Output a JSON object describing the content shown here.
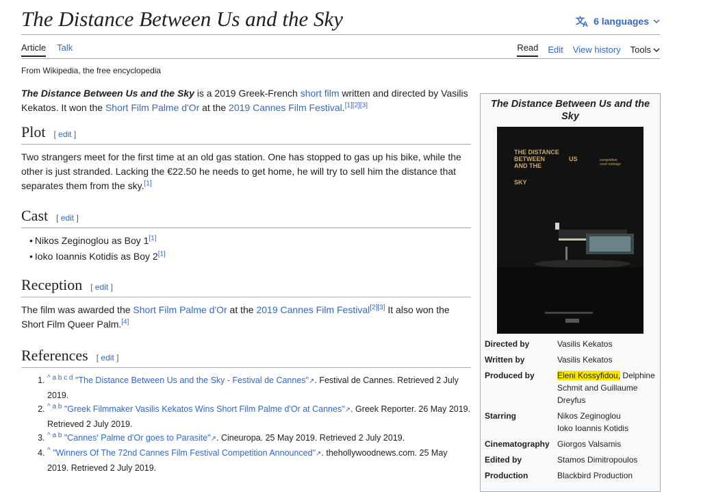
{
  "article": {
    "title": "The Distance Between Us and the Sky",
    "languages": "6 languages",
    "tabs": {
      "article": "Article",
      "talk": "Talk"
    },
    "actions": {
      "read": "Read",
      "edit": "Edit",
      "history": "View history",
      "tools": "Tools"
    },
    "tagline": "From Wikipedia, the free encyclopedia"
  },
  "intro": {
    "bold": "The Distance Between Us and the Sky",
    "t1": " is a 2019 Greek-French ",
    "link1": "short film",
    "t2": " written and directed by Vasilis Kekatos. It won the ",
    "link2": "Short Film Palme d'Or",
    "t3": " at the ",
    "link3": "2019 Cannes Film Festival",
    "t4": ".",
    "refs": "[1][2][3]"
  },
  "edit_label": "edit",
  "plot": {
    "heading": "Plot",
    "text": "Two strangers meet for the first time at an old gas station. One has stopped to gas up his bike, while the other is just stranded. Lacking the €22.50 he needs to get home, he will try to sell him the distance that separates them from the sky.",
    "ref": "[1]"
  },
  "cast": {
    "heading": "Cast",
    "items": [
      {
        "text": "Nikos Zeginoglou as Boy 1",
        "ref": "[1]"
      },
      {
        "text": "Ioko Ioannis Kotidis as Boy 2",
        "ref": "[1]"
      }
    ]
  },
  "reception": {
    "heading": "Reception",
    "t1": "The film was awarded the ",
    "link1": "Short Film Palme d'Or",
    "t2": " at the ",
    "link2": "2019 Cannes Film Festival",
    "refs1": "[2][3]",
    "t3": " It also won the Short Film Queer Palm.",
    "ref2": "[4]"
  },
  "references": {
    "heading": "References",
    "items": [
      {
        "back": "^ a b c d",
        "link": "\"The Distance Between Us and the Sky - Festival de Cannes\"",
        "rest": ". Festival de Cannes. Retrieved 2 July 2019."
      },
      {
        "back": "^ a b",
        "link": "\"Greek Filmmaker Vasilis Kekatos Wins Short Film Palme d'Or at Cannes\"",
        "rest": ". Greek Reporter. 26 May 2019. Retrieved 2 July 2019."
      },
      {
        "back": "^ a b",
        "link": "\"Cannes' Palme d'Or goes to Parasite\"",
        "rest": ". Cineuropa. 25 May 2019. Retrieved 2 July 2019."
      },
      {
        "back": "^",
        "link": "\"Winners Of The 72nd Cannes Film Festival Competition Announced\"",
        "rest": ". thehollywoodnews.com. 25 May 2019. Retrieved 2 July 2019."
      }
    ]
  },
  "infobox": {
    "title": "The Distance Between Us and the Sky",
    "poster": {
      "line1": "THE DISTANCE",
      "line2": "BETWEEN",
      "word_us": "US",
      "line3": "AND THE",
      "line4": "SKY",
      "badge1": "competition",
      "badge2": "court métrage"
    },
    "rows": [
      {
        "k": "Directed by",
        "v": "Vasilis Kekatos"
      },
      {
        "k": "Written by",
        "v": "Vasilis Kekatos"
      },
      {
        "k": "Produced by",
        "hl": "Eleni Kossyfidou,",
        "v": " Delphine Schmit and Guillaume Dreyfus"
      },
      {
        "k": "Starring",
        "v": "Nikos Zeginoglou",
        "v2": "Ioko Ioannis Kotidis"
      },
      {
        "k": "Cinematography",
        "v": "Giorgos Valsamis"
      },
      {
        "k": "Edited by",
        "v": "Stamos Dimitropoulos"
      },
      {
        "k": "Production",
        "v": "Blackbird Production"
      }
    ]
  },
  "colors": {
    "link": "#3366cc",
    "highlight": "#f7e600"
  }
}
